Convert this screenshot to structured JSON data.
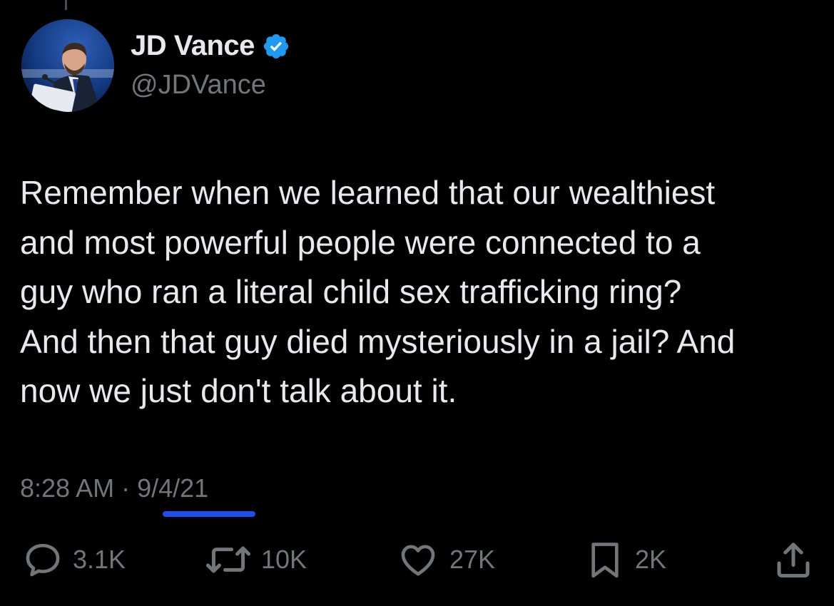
{
  "author": {
    "name": "JD Vance",
    "handle": "@JDVance",
    "verified_color": "#1d9bf0"
  },
  "tweet": {
    "text": "Remember when we learned that our wealthiest\nand most powerful people were connected to a\nguy who ran a literal child sex trafficking ring?\nAnd then that guy died mysteriously in a jail? And\nnow we just don't talk about it.",
    "time": "8:28 AM",
    "separator": "·",
    "date": "9/4/21"
  },
  "actions": {
    "replies": "3.1K",
    "retweets": "10K",
    "likes": "27K",
    "bookmarks": "2K"
  },
  "colors": {
    "background": "#000000",
    "text": "#e7e9ea",
    "secondary": "#71767b",
    "underline": "#1d4ff0"
  },
  "icons": [
    "verified-badge-icon",
    "reply-icon",
    "retweet-icon",
    "like-icon",
    "bookmark-icon",
    "share-icon"
  ]
}
